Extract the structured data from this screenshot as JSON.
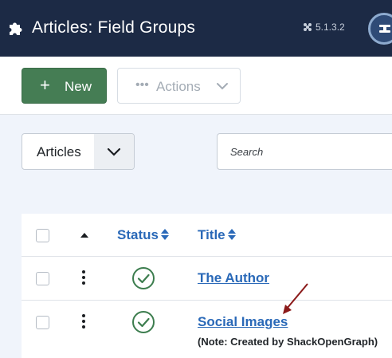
{
  "header": {
    "title": "Articles: Field Groups",
    "logo_icon": "puzzle-icon",
    "version_icon": "joomla-icon",
    "version": "5.1.3.2",
    "user_icon": "user-menu-icon"
  },
  "toolbar": {
    "new_label": "New",
    "new_icon": "plus-icon",
    "actions_label": "Actions",
    "actions_icon": "more-dots-icon"
  },
  "filters": {
    "context_value": "Articles",
    "search_placeholder": "Search"
  },
  "table": {
    "columns": [
      "Status",
      "Title"
    ],
    "rows": [
      {
        "title": "The Author",
        "status": "published",
        "note": ""
      },
      {
        "title": "Social Images",
        "status": "published",
        "note": "(Note: Created by ShackOpenGraph)"
      }
    ]
  },
  "colors": {
    "header_bg": "#1c2a45",
    "new_button": "#457d54",
    "link": "#2a69b8",
    "published": "#3c7d4e",
    "annotation": "#8b1a1a"
  }
}
